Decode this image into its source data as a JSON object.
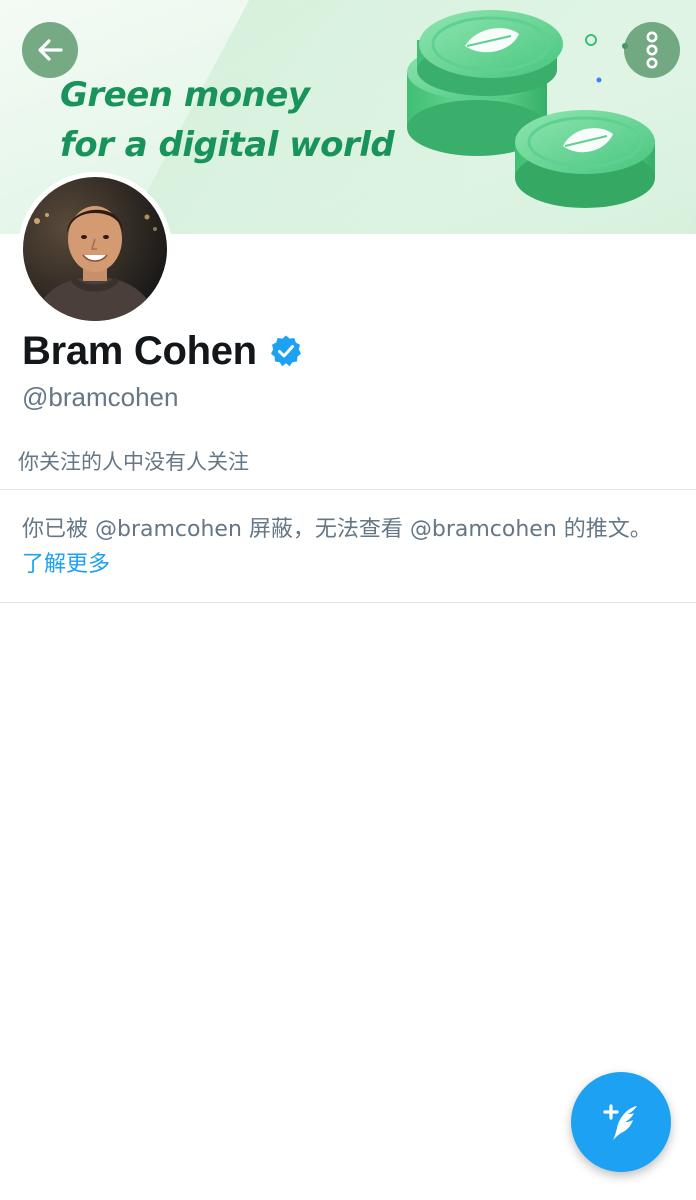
{
  "banner": {
    "headline_line1": "Green money",
    "headline_line2": "for a digital world",
    "art_icon": "green-coins-with-leaf-illustration"
  },
  "nav": {
    "back_icon": "arrow-left-icon",
    "more_icon": "more-vertical-icon"
  },
  "profile": {
    "display_name": "Bram Cohen",
    "verified": true,
    "verified_icon": "verified-badge-icon",
    "handle": "@bramcohen",
    "followers_you_know": "你关注的人中没有人关注"
  },
  "blocked": {
    "message": "你已被 @bramcohen 屏蔽，无法查看 @bramcohen 的推文。",
    "learn_more": "了解更多"
  },
  "fab": {
    "icon": "compose-tweet-icon"
  },
  "colors": {
    "accent": "#1da1f2",
    "banner_green": "#19935c",
    "secondary_text": "#657786",
    "primary_text": "#14171a",
    "divider": "#dfe4e8"
  }
}
